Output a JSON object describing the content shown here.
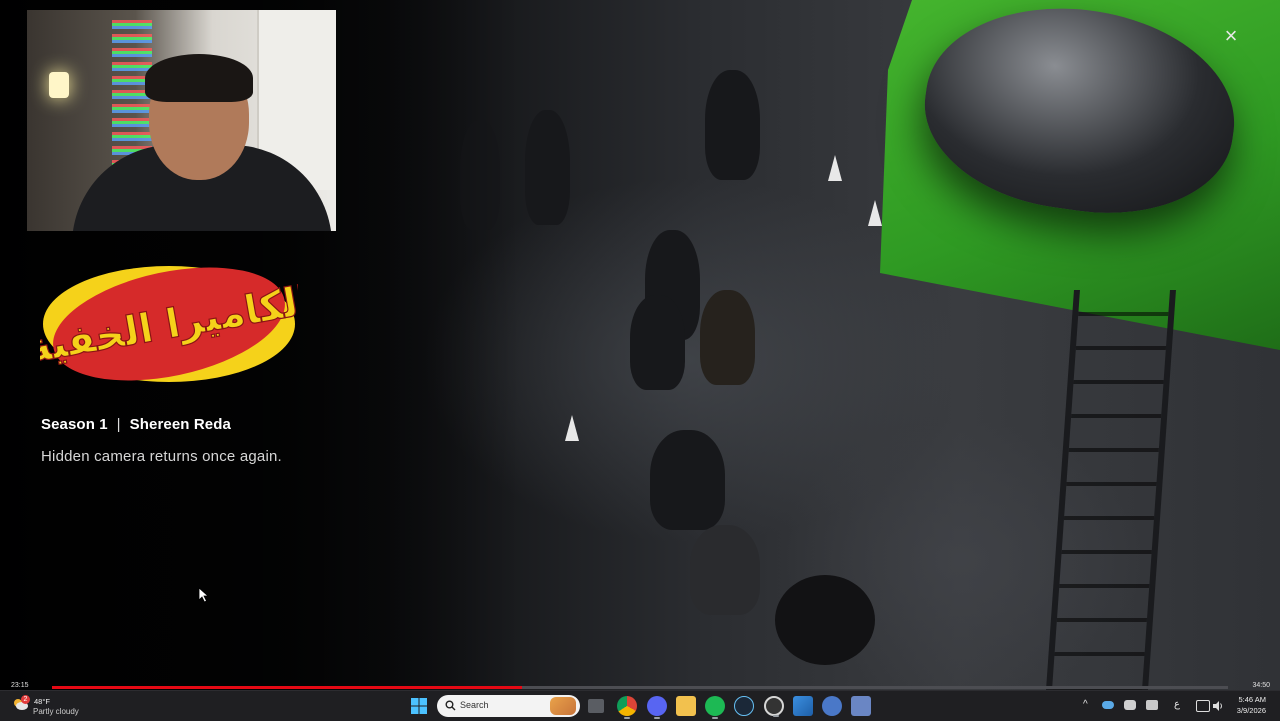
{
  "player": {
    "close_label": "×",
    "title_logo_text": "الكاميرا الخفية",
    "season": "Season 1",
    "separator": "|",
    "host": "Shereen Reda",
    "description": "Hidden camera returns once again.",
    "time_elapsed": "23:15",
    "time_remaining": "34:50",
    "progress_fraction": 0.4
  },
  "taskbar": {
    "weather": {
      "temp": "48°F",
      "condition": "Partly cloudy",
      "badge": "2"
    },
    "search_placeholder": "Search",
    "apps": [
      {
        "name": "file-explorer",
        "active": false
      },
      {
        "name": "chrome",
        "active": true
      },
      {
        "name": "discord",
        "active": true
      },
      {
        "name": "folder",
        "active": false
      },
      {
        "name": "spotify",
        "active": true
      },
      {
        "name": "steam",
        "active": false
      },
      {
        "name": "netflix",
        "active": true
      },
      {
        "name": "photos",
        "active": false
      },
      {
        "name": "app-store",
        "active": false
      },
      {
        "name": "tools",
        "active": false
      }
    ],
    "tray": {
      "chevron": "^",
      "lang": "ع",
      "time": "5:46 AM",
      "date": "3/9/2026"
    }
  },
  "colors": {
    "accent_red": "#e50914",
    "logo_red": "#d62a2a",
    "logo_yellow": "#f5d21a",
    "taskbar_bg": "#1f1f22"
  }
}
